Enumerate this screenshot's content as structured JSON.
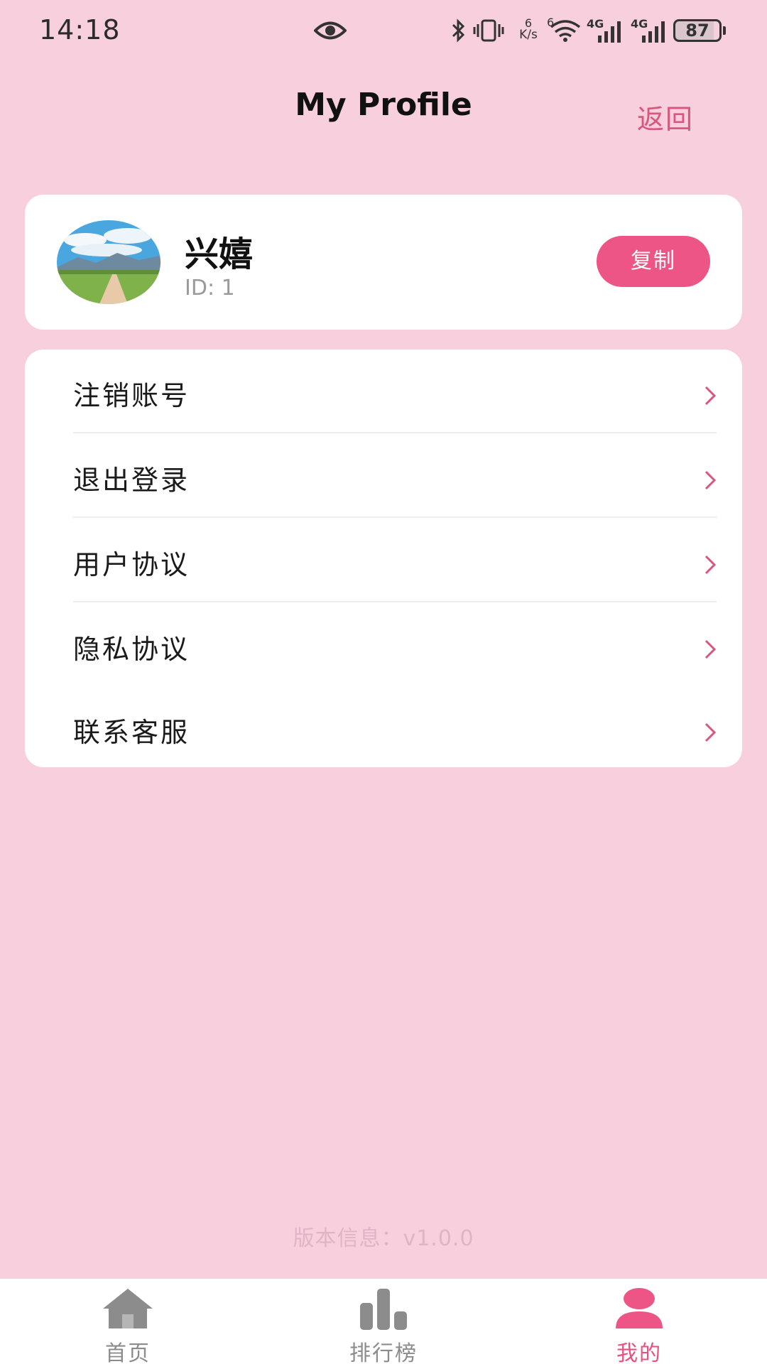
{
  "status_bar": {
    "time": "14:18",
    "net_speed_value": "6",
    "net_speed_unit": "K/s",
    "wifi_badge": "6",
    "signal_1_label": "4G",
    "signal_2_label": "4G",
    "battery_level": "87",
    "icons": [
      "eye-icon",
      "bluetooth-icon",
      "vibrate-icon",
      "wifi-icon",
      "signal-icon",
      "signal-icon",
      "battery-icon"
    ]
  },
  "header": {
    "title": "My Profile",
    "back_label": "返回"
  },
  "profile": {
    "name": "兴嬉",
    "id_text": "ID: 1",
    "copy_label": "复制"
  },
  "menu": {
    "items": [
      {
        "label": "注销账号"
      },
      {
        "label": "退出登录"
      },
      {
        "label": "用户协议"
      },
      {
        "label": "隐私协议"
      },
      {
        "label": "联系客服"
      }
    ]
  },
  "version_text": "版本信息：v1.0.0",
  "bottom_nav": {
    "tabs": [
      {
        "label": "首页",
        "icon": "home-icon"
      },
      {
        "label": "排行榜",
        "icon": "ranking-icon"
      },
      {
        "label": "我的",
        "icon": "profile-icon",
        "active": true
      }
    ]
  },
  "colors": {
    "background": "#f8d0dd",
    "accent": "#ec5585",
    "back_link": "#d9577e",
    "inactive_nav": "#8c8c8c"
  }
}
